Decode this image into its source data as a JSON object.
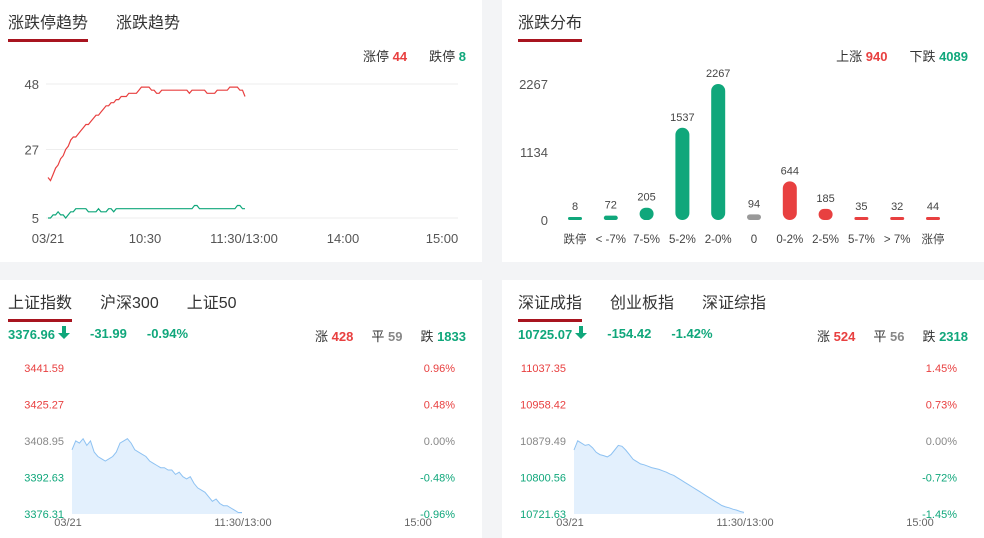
{
  "panel1": {
    "tabs": [
      "涨跌停趋势",
      "涨跌趋势"
    ],
    "active_tab": 0,
    "summary": {
      "up_label": "涨停",
      "up_value": "44",
      "down_label": "跌停",
      "down_value": "8"
    },
    "colors": {
      "up": "#e84040",
      "down": "#10a77b"
    }
  },
  "panel2": {
    "tabs": [
      "涨跌分布"
    ],
    "active_tab": 0,
    "summary": {
      "up_label": "上涨",
      "up_value": "940",
      "down_label": "下跌",
      "down_value": "4089"
    }
  },
  "panel3": {
    "tabs": [
      "上证指数",
      "沪深300",
      "上证50"
    ],
    "active_tab": 0,
    "index_value": "3376.96",
    "change": "-31.99",
    "change_pct": "-0.94%",
    "stats": {
      "up_label": "涨",
      "up_value": "428",
      "flat_label": "平",
      "flat_value": "59",
      "down_label": "跌",
      "down_value": "1833"
    }
  },
  "panel4": {
    "tabs": [
      "深证成指",
      "创业板指",
      "深证综指"
    ],
    "active_tab": 0,
    "index_value": "10725.07",
    "change": "-154.42",
    "change_pct": "-1.42%",
    "stats": {
      "up_label": "涨",
      "up_value": "524",
      "flat_label": "平",
      "flat_value": "56",
      "down_label": "跌",
      "down_value": "2318"
    }
  },
  "chart_data": [
    {
      "type": "line",
      "x_ticks": [
        "03/21",
        "10:30",
        "11:30/13:00",
        "14:00",
        "15:00"
      ],
      "y_ticks": [
        "5",
        "27",
        "48"
      ],
      "ylim": [
        5,
        48
      ],
      "series": [
        {
          "name": "涨停",
          "color": "#e84040",
          "values": [
            18,
            17,
            19,
            21,
            22,
            24,
            25,
            27,
            28,
            30,
            31,
            31,
            32,
            33,
            34,
            35,
            35,
            36,
            37,
            38,
            38,
            39,
            40,
            41,
            41,
            42,
            42,
            43,
            43,
            44,
            44,
            44,
            45,
            45,
            45,
            45,
            46,
            47,
            47,
            47,
            47,
            46,
            46,
            45,
            45,
            46,
            46,
            46,
            46,
            46,
            46,
            46,
            46,
            46,
            46,
            46,
            45,
            46,
            46,
            46,
            46,
            46,
            46,
            45,
            45,
            45,
            45,
            46,
            46,
            46,
            46,
            46,
            47,
            47,
            47,
            47,
            46,
            46,
            44
          ]
        },
        {
          "name": "跌停",
          "color": "#10a77b",
          "values": [
            5,
            5,
            6,
            6,
            7,
            6,
            6,
            5,
            6,
            7,
            7,
            8,
            8,
            8,
            8,
            8,
            7,
            7,
            7,
            7,
            8,
            7,
            7,
            7,
            8,
            8,
            7,
            8,
            8,
            8,
            8,
            8,
            8,
            8,
            8,
            8,
            8,
            8,
            8,
            8,
            8,
            8,
            8,
            8,
            8,
            8,
            8,
            8,
            8,
            8,
            8,
            8,
            8,
            8,
            8,
            8,
            8,
            8,
            9,
            9,
            8,
            8,
            8,
            8,
            8,
            8,
            8,
            8,
            8,
            8,
            8,
            8,
            8,
            8,
            8,
            9,
            9,
            8,
            8
          ]
        }
      ]
    },
    {
      "type": "bar",
      "categories": [
        "跌停",
        "< -7%",
        "7-5%",
        "5-2%",
        "2-0%",
        "0",
        "0-2%",
        "2-5%",
        "5-7%",
        "> 7%",
        "涨停"
      ],
      "values": [
        8,
        72,
        205,
        1537,
        2267,
        94,
        644,
        185,
        35,
        32,
        44
      ],
      "colors": [
        "#10a77b",
        "#10a77b",
        "#10a77b",
        "#10a77b",
        "#10a77b",
        "#999999",
        "#e84040",
        "#e84040",
        "#e84040",
        "#e84040",
        "#e84040"
      ],
      "y_ticks": [
        "0",
        "1134",
        "2267"
      ],
      "ylim": [
        0,
        2267
      ]
    },
    {
      "type": "area",
      "y_ticks_left": [
        "3441.59",
        "3425.27",
        "3408.95",
        "3392.63",
        "3376.31"
      ],
      "y_ticks_right": [
        "0.96%",
        "0.48%",
        "0.00%",
        "-0.48%",
        "-0.96%"
      ],
      "y_tick_colors": [
        "#e84040",
        "#e84040",
        "#888888",
        "#10a77b",
        "#10a77b"
      ],
      "x_ticks": [
        "03/21",
        "11:30/13:00",
        "15:00"
      ],
      "ylim": [
        3376.31,
        3441.59
      ],
      "values": [
        3405,
        3409,
        3408,
        3410,
        3407,
        3409,
        3404,
        3402,
        3401,
        3400,
        3401,
        3402,
        3404,
        3408,
        3409,
        3410,
        3408,
        3405,
        3404,
        3403,
        3402,
        3400,
        3399,
        3398,
        3397,
        3397,
        3396,
        3396,
        3394,
        3395,
        3393,
        3392,
        3393,
        3390,
        3388,
        3387,
        3386,
        3384,
        3382,
        3383,
        3381,
        3380,
        3380,
        3379,
        3378,
        3377,
        3376.96
      ]
    },
    {
      "type": "area",
      "y_ticks_left": [
        "11037.35",
        "10958.42",
        "10879.49",
        "10800.56",
        "10721.63"
      ],
      "y_ticks_right": [
        "1.45%",
        "0.73%",
        "0.00%",
        "-0.72%",
        "-1.45%"
      ],
      "y_tick_colors": [
        "#e84040",
        "#e84040",
        "#888888",
        "#10a77b",
        "#10a77b"
      ],
      "x_ticks": [
        "03/21",
        "11:30/13:00",
        "15:00"
      ],
      "ylim": [
        10721.63,
        11037.35
      ],
      "values": [
        10860,
        10880,
        10875,
        10870,
        10872,
        10865,
        10855,
        10850,
        10848,
        10845,
        10850,
        10860,
        10870,
        10868,
        10860,
        10850,
        10840,
        10835,
        10830,
        10828,
        10825,
        10822,
        10820,
        10818,
        10815,
        10812,
        10808,
        10805,
        10800,
        10795,
        10790,
        10785,
        10780,
        10775,
        10770,
        10765,
        10760,
        10755,
        10750,
        10745,
        10740,
        10737,
        10735,
        10732,
        10730,
        10727,
        10725.07
      ]
    }
  ]
}
